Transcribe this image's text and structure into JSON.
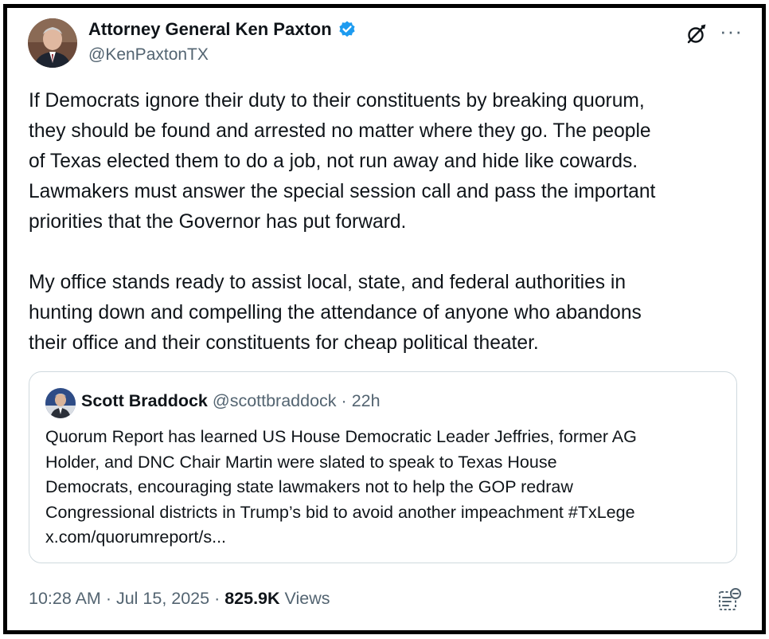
{
  "author": {
    "name": "Attorney General Ken Paxton",
    "handle": "@KenPaxtonTX",
    "verified_icon": "verified-badge-icon",
    "verified_color": "#1d9bf0"
  },
  "header_actions": {
    "grok_icon": "grok-icon",
    "more_label": "···"
  },
  "tweet": {
    "text": "If Democrats ignore their duty to their constituents by breaking quorum,\nthey should be found and arrested no matter where they go. The people\nof Texas elected them to do a job, not run away and hide like cowards.\nLawmakers must answer the special session call and pass the important\npriorities that the Governor has put forward.\n\nMy office stands ready to assist local, state, and federal authorities in\nhunting down and compelling the attendance of anyone who abandons\ntheir office and their constituents for cheap political theater."
  },
  "quoted_tweet": {
    "name": "Scott Braddock",
    "handle": "@scottbraddock",
    "separator": "·",
    "time": "22h",
    "text": "Quorum Report has learned US House Democratic Leader Jeffries, former AG\nHolder, and DNC Chair Martin were slated to speak to Texas House\nDemocrats, encouraging state lawmakers not to help the GOP redraw\nCongressional districts in Trump’s bid to avoid another impeachment #TxLege\nx.com/quorumreport/s..."
  },
  "footer": {
    "timestamp": "10:28 AM · Jul 15, 2025 · ",
    "views_count": "825.9K",
    "views_label": " Views",
    "bookmark_icon": "bookmark-icon"
  }
}
